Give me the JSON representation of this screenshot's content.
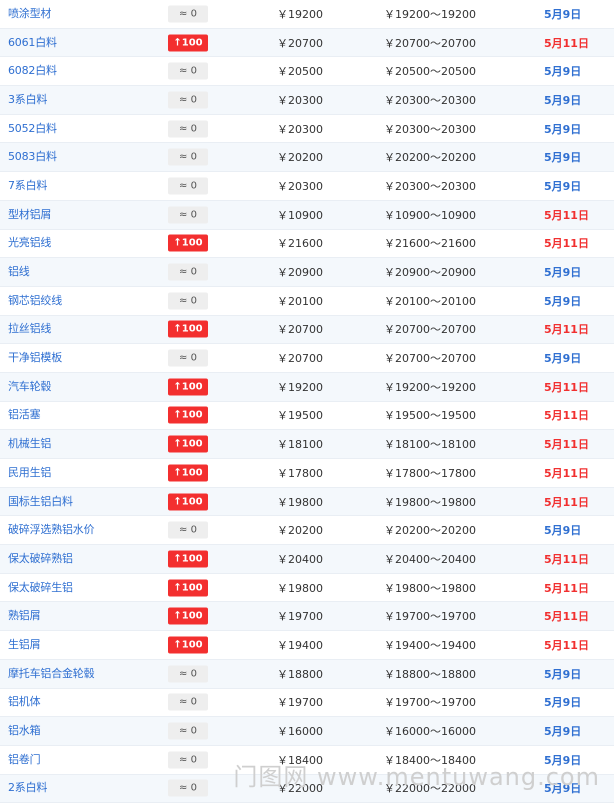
{
  "rows": [
    {
      "name": "喷涂型材",
      "change": "≈ 0",
      "trend": "flat",
      "price": "￥19200",
      "range": "￥19200～19200",
      "date": "5月9日"
    },
    {
      "name": "6061白料",
      "change": "↑100",
      "trend": "up",
      "price": "￥20700",
      "range": "￥20700～20700",
      "date": "5月11日"
    },
    {
      "name": "6082白料",
      "change": "≈ 0",
      "trend": "flat",
      "price": "￥20500",
      "range": "￥20500～20500",
      "date": "5月9日"
    },
    {
      "name": "3系白料",
      "change": "≈ 0",
      "trend": "flat",
      "price": "￥20300",
      "range": "￥20300～20300",
      "date": "5月9日"
    },
    {
      "name": "5052白料",
      "change": "≈ 0",
      "trend": "flat",
      "price": "￥20300",
      "range": "￥20300～20300",
      "date": "5月9日"
    },
    {
      "name": "5083白料",
      "change": "≈ 0",
      "trend": "flat",
      "price": "￥20200",
      "range": "￥20200～20200",
      "date": "5月9日"
    },
    {
      "name": "7系白料",
      "change": "≈ 0",
      "trend": "flat",
      "price": "￥20300",
      "range": "￥20300～20300",
      "date": "5月9日"
    },
    {
      "name": "型材铝屑",
      "change": "≈ 0",
      "trend": "flat",
      "price": "￥10900",
      "range": "￥10900～10900",
      "date": "5月11日"
    },
    {
      "name": "光亮铝线",
      "change": "↑100",
      "trend": "up",
      "price": "￥21600",
      "range": "￥21600～21600",
      "date": "5月11日"
    },
    {
      "name": "铝线",
      "change": "≈ 0",
      "trend": "flat",
      "price": "￥20900",
      "range": "￥20900～20900",
      "date": "5月9日"
    },
    {
      "name": "钢芯铝绞线",
      "change": "≈ 0",
      "trend": "flat",
      "price": "￥20100",
      "range": "￥20100～20100",
      "date": "5月9日"
    },
    {
      "name": "拉丝铝线",
      "change": "↑100",
      "trend": "up",
      "price": "￥20700",
      "range": "￥20700～20700",
      "date": "5月11日"
    },
    {
      "name": "干净铝模板",
      "change": "≈ 0",
      "trend": "flat",
      "price": "￥20700",
      "range": "￥20700～20700",
      "date": "5月9日"
    },
    {
      "name": "汽车轮毂",
      "change": "↑100",
      "trend": "up",
      "price": "￥19200",
      "range": "￥19200～19200",
      "date": "5月11日"
    },
    {
      "name": "铝活塞",
      "change": "↑100",
      "trend": "up",
      "price": "￥19500",
      "range": "￥19500～19500",
      "date": "5月11日"
    },
    {
      "name": "机械生铝",
      "change": "↑100",
      "trend": "up",
      "price": "￥18100",
      "range": "￥18100～18100",
      "date": "5月11日"
    },
    {
      "name": "民用生铝",
      "change": "↑100",
      "trend": "up",
      "price": "￥17800",
      "range": "￥17800～17800",
      "date": "5月11日"
    },
    {
      "name": "国标生铝白料",
      "change": "↑100",
      "trend": "up",
      "price": "￥19800",
      "range": "￥19800～19800",
      "date": "5月11日"
    },
    {
      "name": "破碎浮选熟铝水价",
      "change": "≈ 0",
      "trend": "flat",
      "price": "￥20200",
      "range": "￥20200～20200",
      "date": "5月9日"
    },
    {
      "name": "保太破碎熟铝",
      "change": "↑100",
      "trend": "up",
      "price": "￥20400",
      "range": "￥20400～20400",
      "date": "5月11日"
    },
    {
      "name": "保太破碎生铝",
      "change": "↑100",
      "trend": "up",
      "price": "￥19800",
      "range": "￥19800～19800",
      "date": "5月11日"
    },
    {
      "name": "熟铝屑",
      "change": "↑100",
      "trend": "up",
      "price": "￥19700",
      "range": "￥19700～19700",
      "date": "5月11日"
    },
    {
      "name": "生铝屑",
      "change": "↑100",
      "trend": "up",
      "price": "￥19400",
      "range": "￥19400～19400",
      "date": "5月11日"
    },
    {
      "name": "摩托车铝合金轮毂",
      "change": "≈ 0",
      "trend": "flat",
      "price": "￥18800",
      "range": "￥18800～18800",
      "date": "5月9日"
    },
    {
      "name": "铝机体",
      "change": "≈ 0",
      "trend": "flat",
      "price": "￥19700",
      "range": "￥19700～19700",
      "date": "5月9日"
    },
    {
      "name": "铝水箱",
      "change": "≈ 0",
      "trend": "flat",
      "price": "￥16000",
      "range": "￥16000～16000",
      "date": "5月9日"
    },
    {
      "name": "铝卷门",
      "change": "≈ 0",
      "trend": "flat",
      "price": "￥18400",
      "range": "￥18400～18400",
      "date": "5月9日"
    },
    {
      "name": "2系白料",
      "change": "≈ 0",
      "trend": "flat",
      "price": "￥22000",
      "range": "￥22000～22000",
      "date": "5月9日"
    }
  ],
  "watermark": "门图网 www.mentuwang.com"
}
